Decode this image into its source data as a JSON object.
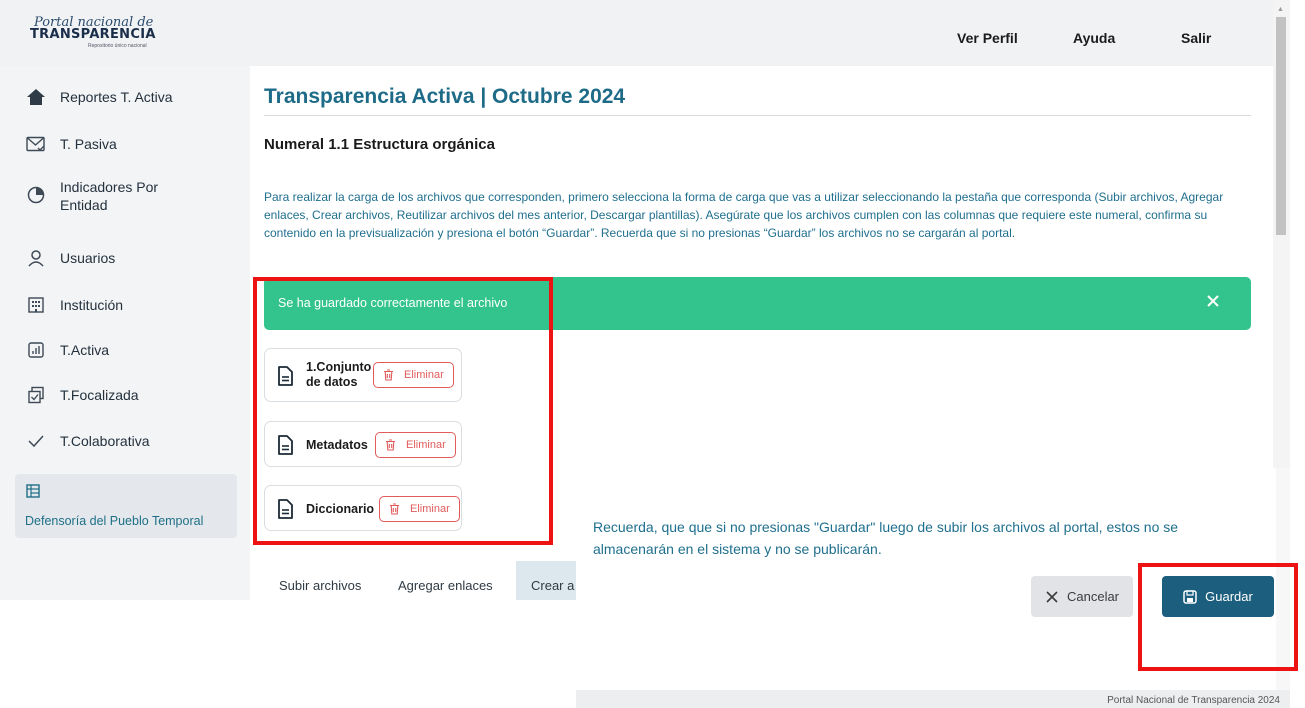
{
  "header": {
    "logo": {
      "line1": "Portal nacional de",
      "line2": "TRANSPARENCIA",
      "line3": "Repositorio único nacional"
    },
    "nav": [
      "Ver Perfil",
      "Ayuda",
      "Salir"
    ]
  },
  "sidebar": {
    "items": [
      {
        "label": "Reportes T. Activa",
        "icon": "home-icon"
      },
      {
        "label": "T. Pasiva",
        "icon": "mail-icon"
      },
      {
        "label": "Indicadores Por Entidad",
        "icon": "pie-chart-icon"
      },
      {
        "label": "Usuarios",
        "icon": "user-icon"
      },
      {
        "label": "Institución",
        "icon": "building-icon"
      },
      {
        "label": "T.Activa",
        "icon": "bar-chart-icon"
      },
      {
        "label": "T.Focalizada",
        "icon": "copy-check-icon"
      },
      {
        "label": "T.Colaborativa",
        "icon": "check-icon"
      }
    ],
    "entity": {
      "label": "Defensoría del Pueblo Temporal",
      "icon": "entity-icon"
    }
  },
  "main": {
    "title": "Transparencia Activa | Octubre 2024",
    "subtitle": "Numeral 1.1 Estructura orgánica",
    "instructions": "Para realizar la carga de los archivos que corresponden, primero selecciona la forma de carga que vas a utilizar seleccionando la pestaña que corresponda (Subir archivos, Agregar enlaces, Crear archivos, Reutilizar archivos del mes anterior, Descargar plantillas). Asegúrate que los archivos cumplen con las columnas que requiere este numeral, confirma su contenido en la previsualización y presiona el botón “Guardar”. Recuerda que si no presionas “Guardar” los archivos no se cargarán al portal.",
    "alert": "Se ha guardado correctamente el archivo",
    "files": [
      {
        "name_line1": "1.Conjunto",
        "name_line2": "de datos",
        "delete_label": "Eliminar"
      },
      {
        "name_line1": "Metadatos",
        "delete_label": "Eliminar"
      },
      {
        "name_line1": "Diccionario",
        "delete_label": "Eliminar"
      }
    ],
    "tabs": [
      "Subir archivos",
      "Agregar enlaces",
      "Crear a"
    ]
  },
  "overlay": {
    "notice": "Recuerda, que que si no presionas \"Guardar\" luego de subir los archivos al portal, estos no se almacenarán en el sistema y no se publicarán.",
    "cancel_label": "Cancelar",
    "save_label": "Guardar",
    "footer": "Portal Nacional de Transparencia 2024"
  },
  "colors": {
    "brand": "#1e6b88",
    "success": "#33c48d",
    "danger": "#e25b5b",
    "highlight": "#ee1313",
    "primary_button": "#1b5e7e"
  }
}
